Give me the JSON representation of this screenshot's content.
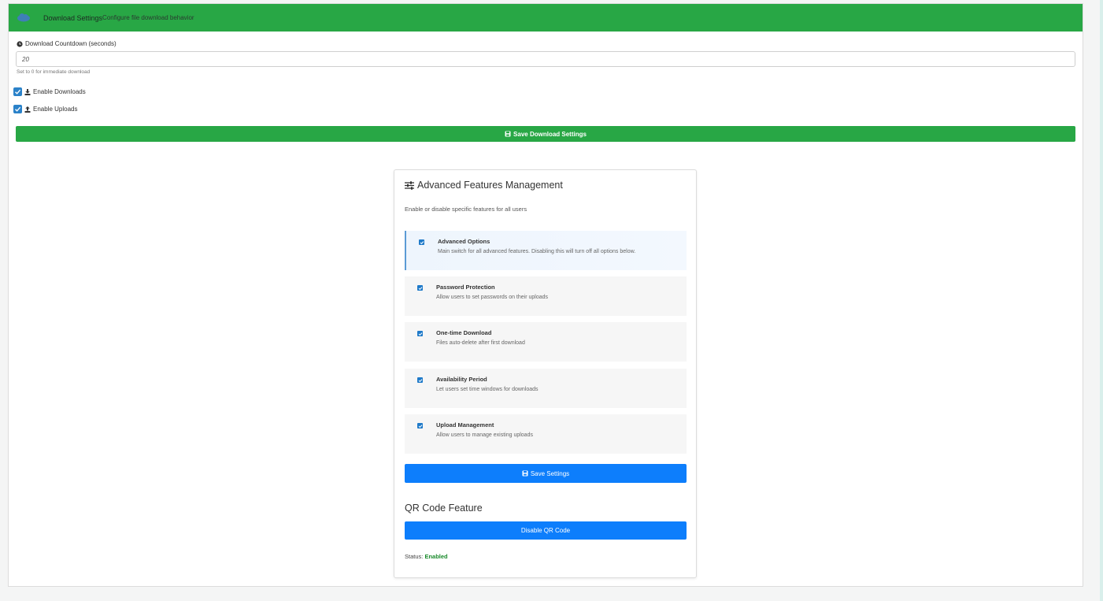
{
  "header": {
    "title": "Download Settings",
    "subtitle": "Configure file download behavior"
  },
  "download_settings": {
    "countdown_label": "Download Countdown (seconds)",
    "countdown_value": "20",
    "countdown_help": "Set to 0 for immediate download",
    "enable_downloads_label": "Enable Downloads",
    "enable_downloads_checked": true,
    "enable_uploads_label": "Enable Uploads",
    "enable_uploads_checked": true,
    "save_label": "Save Download Settings"
  },
  "advanced": {
    "title": "Advanced Features Management",
    "subtitle": "Enable or disable specific features for all users",
    "features": [
      {
        "name": "Advanced Options",
        "desc": "Main switch for all advanced features. Disabling this will turn off all options below.",
        "checked": true
      },
      {
        "name": "Password Protection",
        "desc": "Allow users to set passwords on their uploads",
        "checked": true
      },
      {
        "name": "One-time Download",
        "desc": "Files auto-delete after first download",
        "checked": true
      },
      {
        "name": "Availability Period",
        "desc": "Let users set time windows for downloads",
        "checked": true
      },
      {
        "name": "Upload Management",
        "desc": "Allow users to manage existing uploads",
        "checked": true
      }
    ],
    "save_label": "Save Settings"
  },
  "qr": {
    "title": "QR Code Feature",
    "button_label": "Disable QR Code",
    "status_label": "Status:",
    "status_value": "Enabled"
  },
  "colors": {
    "header_green": "#28a745",
    "primary_blue": "#0d7efc",
    "checkbox_blue": "#2b82c9",
    "status_green": "#198a2b"
  }
}
